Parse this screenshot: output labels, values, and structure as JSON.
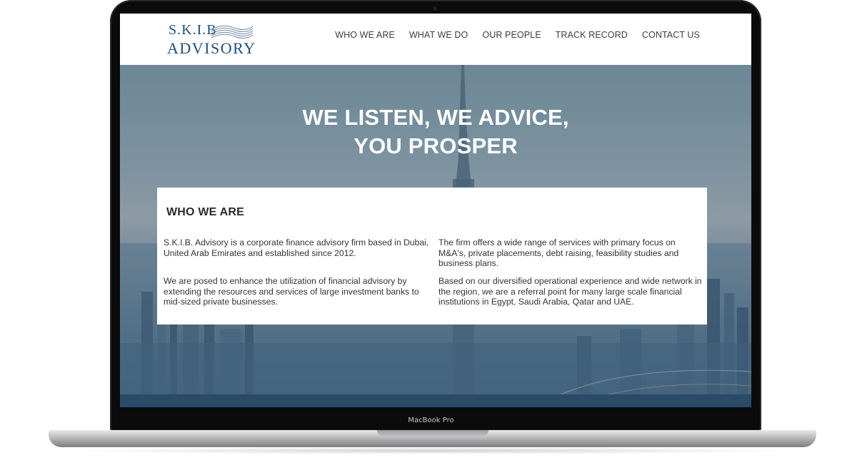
{
  "device": {
    "model_label": "MacBook Pro"
  },
  "logo": {
    "line1": "S.K.I.B",
    "line2": "ADVISORY"
  },
  "nav": {
    "items": [
      {
        "label": "WHO WE ARE"
      },
      {
        "label": "WHAT WE DO"
      },
      {
        "label": "OUR PEOPLE"
      },
      {
        "label": "TRACK RECORD"
      },
      {
        "label": "CONTACT US"
      }
    ]
  },
  "hero": {
    "headline_line1": "WE LISTEN, WE ADVICE,",
    "headline_line2": "YOU PROSPER"
  },
  "about": {
    "title": "WHO WE ARE",
    "paragraphs": [
      "S.K.I.B. Advisory is a corporate finance advisory firm based in Dubai, United Arab Emirates and established since 2012.",
      "The firm offers a wide range of services with primary focus on M&A's, private placements, debt raising, feasibility studies and business plans.",
      "We are posed to enhance the utilization of financial advisory by extending the resources and services of large investment banks to mid-sized private businesses.",
      "Based on our diversified operational experience and wide network in the region, we are a referral point for many large scale financial institutions in Egypt, Saudi Arabia, Qatar and UAE."
    ]
  },
  "colors": {
    "brand": "#214f7d",
    "hero_tint": "#4e6b82",
    "laptop_bezel": "#0b0b0c"
  }
}
